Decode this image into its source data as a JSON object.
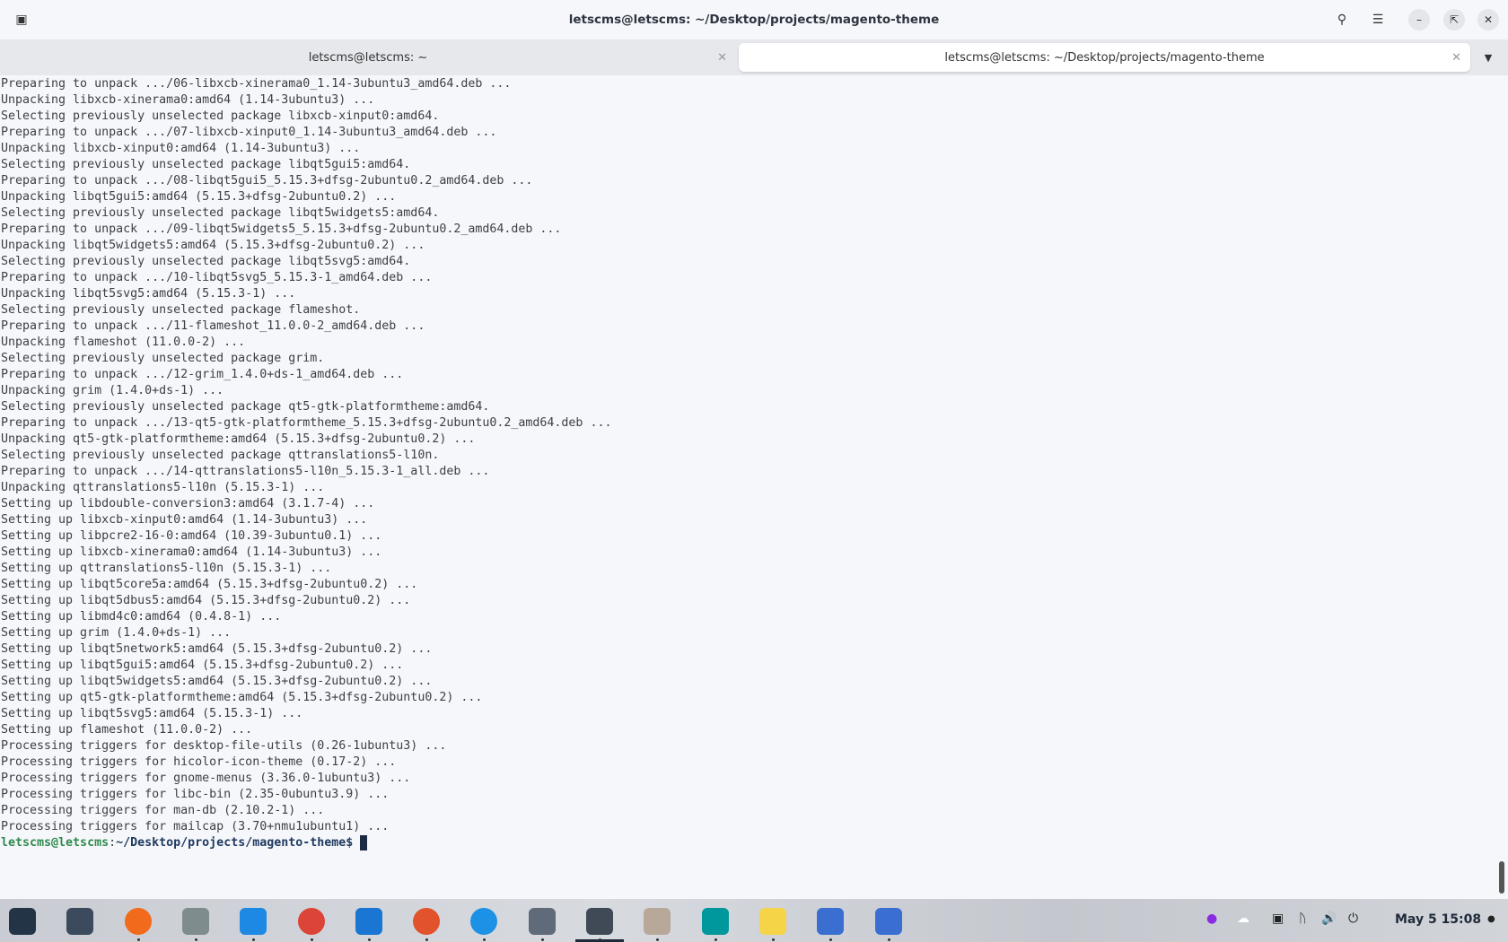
{
  "window": {
    "title": "letscms@letscms: ~/Desktop/projects/magento-theme"
  },
  "tabs": [
    {
      "label": "letscms@letscms: ~"
    },
    {
      "label": "letscms@letscms: ~/Desktop/projects/magento-theme"
    }
  ],
  "terminal": {
    "lines": [
      "Preparing to unpack .../06-libxcb-xinerama0_1.14-3ubuntu3_amd64.deb ...",
      "Unpacking libxcb-xinerama0:amd64 (1.14-3ubuntu3) ...",
      "Selecting previously unselected package libxcb-xinput0:amd64.",
      "Preparing to unpack .../07-libxcb-xinput0_1.14-3ubuntu3_amd64.deb ...",
      "Unpacking libxcb-xinput0:amd64 (1.14-3ubuntu3) ...",
      "Selecting previously unselected package libqt5gui5:amd64.",
      "Preparing to unpack .../08-libqt5gui5_5.15.3+dfsg-2ubuntu0.2_amd64.deb ...",
      "Unpacking libqt5gui5:amd64 (5.15.3+dfsg-2ubuntu0.2) ...",
      "Selecting previously unselected package libqt5widgets5:amd64.",
      "Preparing to unpack .../09-libqt5widgets5_5.15.3+dfsg-2ubuntu0.2_amd64.deb ...",
      "Unpacking libqt5widgets5:amd64 (5.15.3+dfsg-2ubuntu0.2) ...",
      "Selecting previously unselected package libqt5svg5:amd64.",
      "Preparing to unpack .../10-libqt5svg5_5.15.3-1_amd64.deb ...",
      "Unpacking libqt5svg5:amd64 (5.15.3-1) ...",
      "Selecting previously unselected package flameshot.",
      "Preparing to unpack .../11-flameshot_11.0.0-2_amd64.deb ...",
      "Unpacking flameshot (11.0.0-2) ...",
      "Selecting previously unselected package grim.",
      "Preparing to unpack .../12-grim_1.4.0+ds-1_amd64.deb ...",
      "Unpacking grim (1.4.0+ds-1) ...",
      "Selecting previously unselected package qt5-gtk-platformtheme:amd64.",
      "Preparing to unpack .../13-qt5-gtk-platformtheme_5.15.3+dfsg-2ubuntu0.2_amd64.deb ...",
      "Unpacking qt5-gtk-platformtheme:amd64 (5.15.3+dfsg-2ubuntu0.2) ...",
      "Selecting previously unselected package qttranslations5-l10n.",
      "Preparing to unpack .../14-qttranslations5-l10n_5.15.3-1_all.deb ...",
      "Unpacking qttranslations5-l10n (5.15.3-1) ...",
      "Setting up libdouble-conversion3:amd64 (3.1.7-4) ...",
      "Setting up libxcb-xinput0:amd64 (1.14-3ubuntu3) ...",
      "Setting up libpcre2-16-0:amd64 (10.39-3ubuntu0.1) ...",
      "Setting up libxcb-xinerama0:amd64 (1.14-3ubuntu3) ...",
      "Setting up qttranslations5-l10n (5.15.3-1) ...",
      "Setting up libqt5core5a:amd64 (5.15.3+dfsg-2ubuntu0.2) ...",
      "Setting up libqt5dbus5:amd64 (5.15.3+dfsg-2ubuntu0.2) ...",
      "Setting up libmd4c0:amd64 (0.4.8-1) ...",
      "Setting up grim (1.4.0+ds-1) ...",
      "Setting up libqt5network5:amd64 (5.15.3+dfsg-2ubuntu0.2) ...",
      "Setting up libqt5gui5:amd64 (5.15.3+dfsg-2ubuntu0.2) ...",
      "Setting up libqt5widgets5:amd64 (5.15.3+dfsg-2ubuntu0.2) ...",
      "Setting up qt5-gtk-platformtheme:amd64 (5.15.3+dfsg-2ubuntu0.2) ...",
      "Setting up libqt5svg5:amd64 (5.15.3-1) ...",
      "Setting up flameshot (11.0.0-2) ...",
      "Processing triggers for desktop-file-utils (0.26-1ubuntu3) ...",
      "Processing triggers for hicolor-icon-theme (0.17-2) ...",
      "Processing triggers for gnome-menus (3.36.0-1ubuntu3) ...",
      "Processing triggers for libc-bin (2.35-0ubuntu3.9) ...",
      "Processing triggers for man-db (2.10.2-1) ...",
      "Processing triggers for mailcap (3.70+nmu1ubuntu1) ..."
    ],
    "prompt_user": "letscms@letscms",
    "prompt_sep": ":",
    "prompt_path": "~/Desktop/projects/magento-theme$"
  },
  "taskbar": {
    "apps": [
      "zorin-menu",
      "workspaces",
      "firefox",
      "files",
      "software-store",
      "chrome",
      "vscode",
      "brave",
      "docker",
      "settings",
      "terminal",
      "archive",
      "arduino",
      "text-editor",
      "remote-1",
      "remote-2"
    ],
    "clock": "May 5  15:08"
  },
  "colors": {
    "prompt_user": "#2f8a4f",
    "prompt_path": "#1f3a60"
  }
}
